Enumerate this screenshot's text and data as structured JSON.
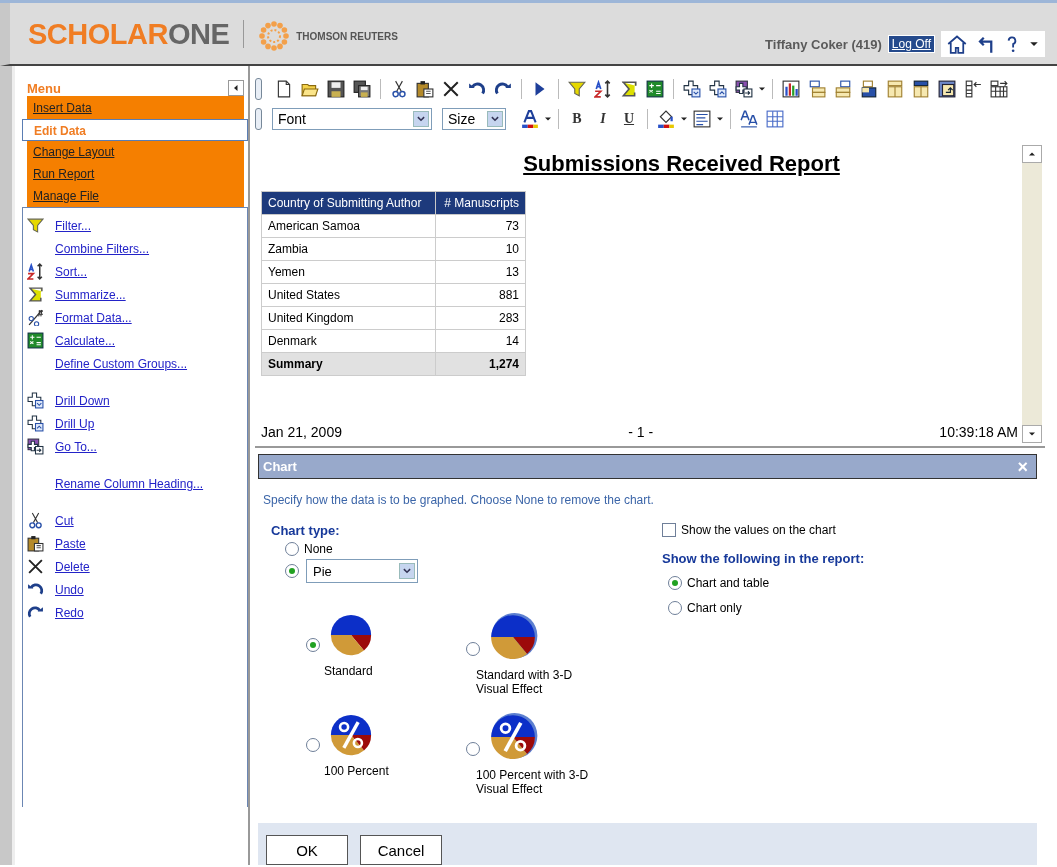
{
  "header": {
    "logo": {
      "first": "SCHOLAR",
      "second": "ONE"
    },
    "publisher": "THOMSON REUTERS",
    "user": "Tiffany Coker (419)",
    "log_off": "Log Off"
  },
  "menu": {
    "title": "Menu",
    "items": [
      {
        "label": "Insert Data",
        "selected": false
      },
      {
        "label": "Edit Data",
        "selected": true
      },
      {
        "label": "Change Layout",
        "selected": false
      },
      {
        "label": "Run Report",
        "selected": false
      },
      {
        "label": "Manage File",
        "selected": false
      }
    ]
  },
  "action_groups": [
    [
      {
        "label": "Filter...",
        "kind": "filter"
      },
      {
        "label": "Combine Filters..."
      },
      {
        "label": "Sort...",
        "kind": "sort"
      },
      {
        "label": "Summarize...",
        "kind": "sum"
      },
      {
        "label": "Format Data...",
        "kind": "format"
      },
      {
        "label": "Calculate...",
        "kind": "calc"
      },
      {
        "label": "Define Custom Groups..."
      }
    ],
    [
      {
        "label": "Drill Down",
        "kind": "drilldown"
      },
      {
        "label": "Drill Up",
        "kind": "drillup"
      },
      {
        "label": "Go To...",
        "kind": "goto"
      }
    ],
    [
      {
        "label": "Rename Column Heading..."
      }
    ],
    [
      {
        "label": "Cut",
        "kind": "cut"
      },
      {
        "label": "Paste",
        "kind": "paste"
      },
      {
        "label": "Delete",
        "kind": "delete"
      },
      {
        "label": "Undo",
        "kind": "undo"
      },
      {
        "label": "Redo",
        "kind": "redo"
      }
    ]
  ],
  "format_bar": {
    "font": "Font",
    "size": "Size",
    "bold": "B",
    "italic": "I",
    "underline": "U"
  },
  "report": {
    "title": "Submissions Received Report",
    "table": {
      "columns": [
        "Country of Submitting Author",
        "# Manuscripts"
      ],
      "rows": [
        [
          "American Samoa",
          "73"
        ],
        [
          "Zambia",
          "10"
        ],
        [
          "Yemen",
          "13"
        ],
        [
          "United States",
          "881"
        ],
        [
          "United Kingdom",
          "283"
        ],
        [
          "Denmark",
          "14"
        ]
      ],
      "summary": [
        "Summary",
        "1,274"
      ]
    },
    "footer": {
      "date": "Jan 21, 2009",
      "page": "- 1 -",
      "time": "10:39:18 AM"
    }
  },
  "chart_panel": {
    "title": "Chart",
    "close": "×",
    "description": "Specify how the data is to be graphed. Choose None to remove the chart.",
    "chart_type": {
      "label": "Chart type:",
      "none_label": "None",
      "none_selected": false,
      "pie_selected": true,
      "value": "Pie"
    },
    "styles": [
      {
        "label": "Standard",
        "kind": "standard",
        "selected": true
      },
      {
        "label": "Standard with 3-D Visual Effect",
        "kind": "standard-3d",
        "selected": false
      },
      {
        "label": "100 Percent",
        "kind": "percent",
        "selected": false
      },
      {
        "label": "100 Percent with 3-D Visual Effect",
        "kind": "percent-3d",
        "selected": false
      }
    ],
    "show_values": {
      "label": "Show the values on the chart",
      "checked": false
    },
    "show": {
      "label": "Show the following in the report:",
      "options": [
        {
          "label": "Chart and table",
          "selected": true
        },
        {
          "label": "Chart only",
          "selected": false
        }
      ]
    },
    "buttons": [
      "OK",
      "Cancel"
    ]
  }
}
